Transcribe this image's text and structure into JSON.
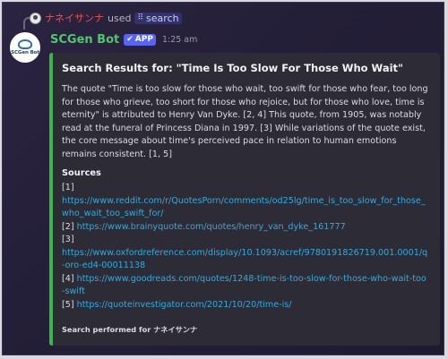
{
  "reply": {
    "user_name": "ナネイサンナ",
    "used_text": "used",
    "command_name": "search"
  },
  "bot": {
    "name": "SCGen Bot",
    "avatar_text": "SCGen Bot",
    "badge": "APP",
    "timestamp": "1:25 am"
  },
  "embed": {
    "accent_color": "#3bb54a",
    "title": "Search Results for: \"Time Is Too Slow For Those Who Wait\"",
    "description": "The quote \"Time is too slow for those who wait, too swift for those who fear, too long for those who grieve, too short for those who rejoice, but for those who love, time is eternity\" is attributed to Henry Van Dyke. [2, 4] This quote, from 1905, was notably read at the funeral of Princess Diana in 1997. [3] While variations of the quote exist, the core message about time's perceived pace in relation to human emotions remains consistent. [1, 5]",
    "sources_heading": "Sources",
    "sources": [
      {
        "ref": "[1]",
        "url": "https://www.reddit.com/r/QuotesPorn/comments/od25lg/time_is_too_slow_for_those_who_wait_too_swift_for/"
      },
      {
        "ref": "[2]",
        "url": "https://www.brainyquote.com/quotes/henry_van_dyke_161777"
      },
      {
        "ref": "[3]",
        "url": "https://www.oxfordreference.com/display/10.1093/acref/9780191826719.001.0001/q-oro-ed4-00011138"
      },
      {
        "ref": "[4]",
        "url": "https://www.goodreads.com/quotes/1248-time-is-too-slow-for-those-who-wait-too-swift"
      },
      {
        "ref": "[5]",
        "url": "https://quoteinvestigator.com/2021/10/20/time-is/"
      }
    ],
    "footer": "Search performed for ナネイサンナ"
  }
}
